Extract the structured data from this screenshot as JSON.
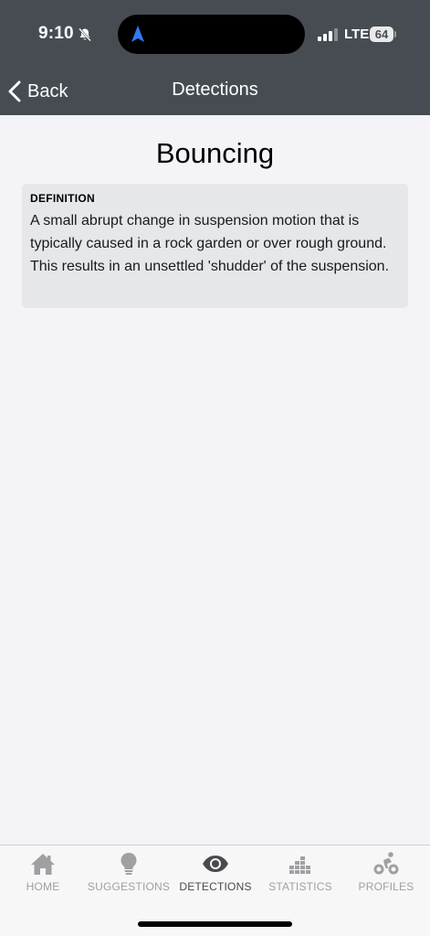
{
  "status_bar": {
    "time": "9:10",
    "network": "LTE",
    "battery": "64"
  },
  "nav": {
    "back_label": "Back",
    "title": "Detections"
  },
  "main": {
    "title": "Bouncing",
    "definition": {
      "heading": "DEFINITION",
      "text": "A small abrupt change in suspension motion that is typically caused in a rock garden or over rough ground. This results in an unsettled 'shudder' of the suspension."
    }
  },
  "tab_bar": {
    "active": "detections",
    "tabs": [
      {
        "id": "home",
        "label": "HOME",
        "icon": "house-icon"
      },
      {
        "id": "suggestions",
        "label": "SUGGESTIONS",
        "icon": "lightbulb-icon"
      },
      {
        "id": "detections",
        "label": "DETECTIONS",
        "icon": "eye-icon"
      },
      {
        "id": "statistics",
        "label": "STATISTICS",
        "icon": "bar-chart-icon"
      },
      {
        "id": "profiles",
        "label": "PROFILES",
        "icon": "cyclist-icon"
      }
    ]
  },
  "colors": {
    "header_bg": "#474c53",
    "page_bg": "#f4f4f8",
    "card_bg": "#e5e7ea",
    "tab_inactive": "#a0a0a4",
    "tab_active": "#4a4a4e",
    "location_arrow": "#2f7bf5"
  }
}
